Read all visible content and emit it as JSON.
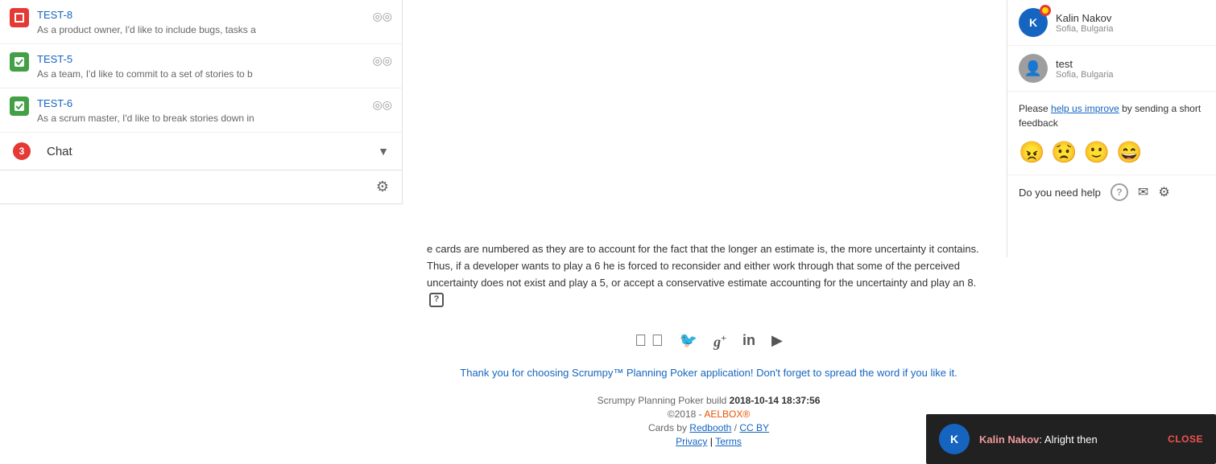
{
  "tasks": [
    {
      "id": "TEST-8",
      "icon_type": "red",
      "icon_letter": "▣",
      "description": "As a product owner, I'd like to include bugs, tasks a",
      "link": "#test-8"
    },
    {
      "id": "TEST-5",
      "icon_type": "green",
      "icon_letter": "▣",
      "description": "As a team, I'd like to commit to a set of stories to b",
      "link": "#test-5"
    },
    {
      "id": "TEST-6",
      "icon_type": "green",
      "icon_letter": "▣",
      "description": "As a scrum master, I'd like to break stories down in",
      "link": "#test-6"
    }
  ],
  "chat": {
    "label": "Chat",
    "badge": "3"
  },
  "main_description": "e cards are numbered as they are to account for the fact that the longer an estimate is, the more uncertainty it contains. Thus, if a developer wants to play a 6 he is forced to reconsider and either work through that some of the perceived uncertainty does not exist and play a 5, or accept a conservative estimate accounting for the uncertainty and play an 8.",
  "social": {
    "facebook": "f",
    "twitter": "🐦",
    "google_plus": "g+",
    "linkedin": "in",
    "youtube": "▶"
  },
  "thank_you_text": "Thank you for choosing Scrumpy™ Planning Poker application! Don't forget to spread the word if you like it.",
  "footer": {
    "build_label": "Scrumpy Planning Poker build ",
    "build_date": "2018-10-14 18:37:56",
    "copyright": "©2018 - ",
    "copyright_link": "AELBOX®",
    "cards_text": "Cards by ",
    "cards_link": "Redbooth",
    "cc_text": " / ",
    "cc_link": "CC BY",
    "privacy": "Privacy",
    "separator": " | ",
    "terms": "Terms"
  },
  "right_panel": {
    "users": [
      {
        "name": "Kalin Nakov",
        "location": "Sofia, Bulgaria",
        "avatar_letter": "K",
        "has_badge": true
      },
      {
        "name": "test",
        "location": "Sofia, Bulgaria",
        "avatar_letter": "👤",
        "has_badge": false
      }
    ],
    "feedback": {
      "text": "Please help us improve by sending a short feedback"
    },
    "emojis": [
      "😠",
      "😟",
      "🙂",
      "😄"
    ],
    "help": {
      "label": "Do you need help"
    }
  },
  "notification": {
    "sender_name": "Kalin Nakov",
    "message": ": Alright then",
    "close_label": "CLOSE",
    "avatar_letter": "K"
  }
}
